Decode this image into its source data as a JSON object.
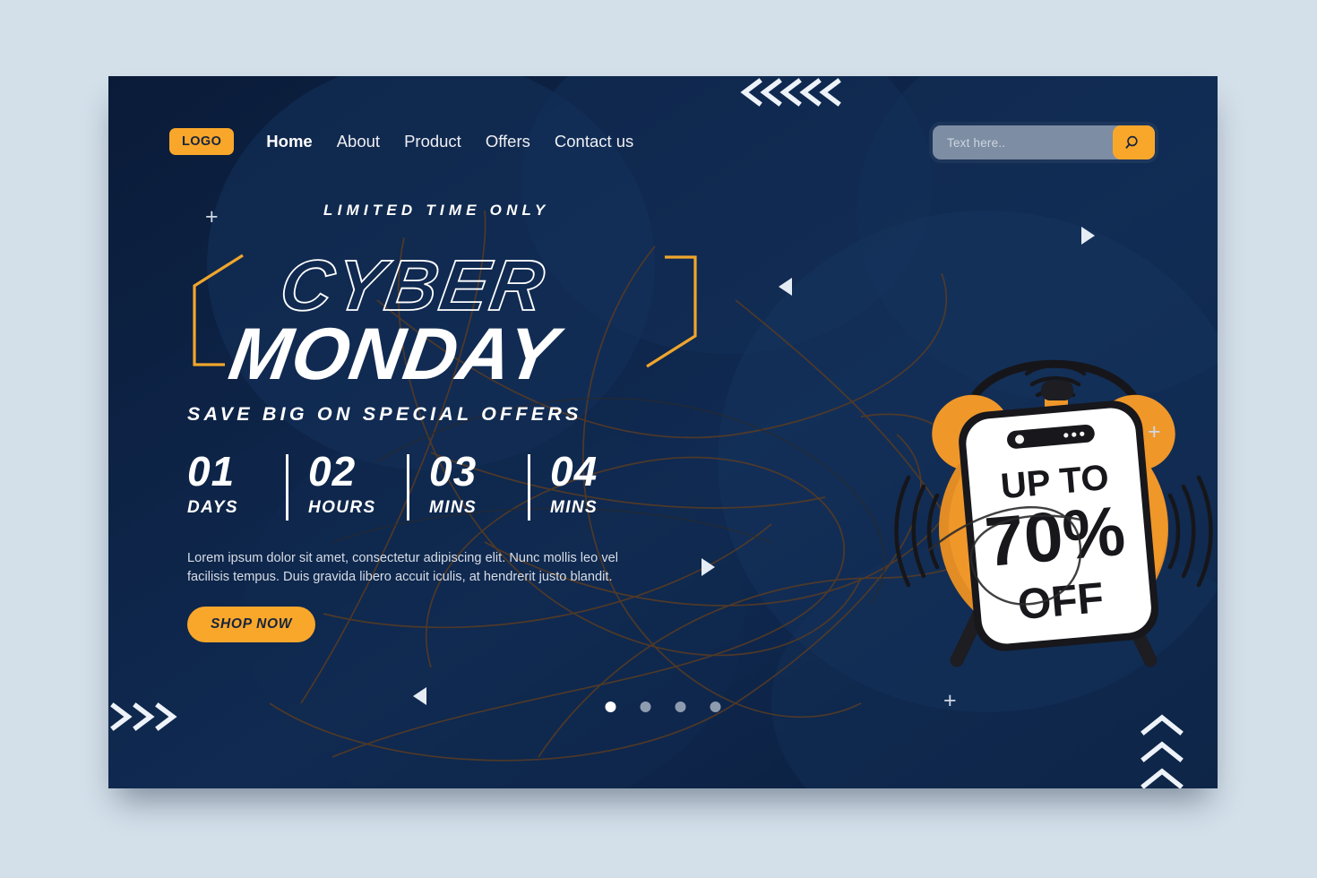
{
  "page": {
    "background_color": "#d3dfe9",
    "card_color": "#0b1f3f",
    "accent_color": "#f9a72b"
  },
  "nav": {
    "logo": "LOGO",
    "items": [
      {
        "label": "Home",
        "active": true
      },
      {
        "label": "About",
        "active": false
      },
      {
        "label": "Product",
        "active": false
      },
      {
        "label": "Offers",
        "active": false
      },
      {
        "label": "Contact us",
        "active": false
      }
    ]
  },
  "search": {
    "placeholder": "Text here..",
    "value": "",
    "icon": "search-icon"
  },
  "hero": {
    "kicker": "LIMITED TIME ONLY",
    "title_line1": "CYBER",
    "title_line2": "MONDAY",
    "subhead": "SAVE BIG ON SPECIAL OFFERS",
    "paragraph": "Lorem ipsum dolor sit amet, consectetur adipiscing elit. Nunc mollis leo vel facilisis tempus. Duis gravida libero accuit iculis, at hendrerit justo blandit.",
    "cta_label": "SHOP NOW"
  },
  "countdown": {
    "units": [
      {
        "value": "01",
        "label": "DAYS"
      },
      {
        "value": "02",
        "label": "HOURS"
      },
      {
        "value": "03",
        "label": "MINS"
      },
      {
        "value": "04",
        "label": "MINS"
      }
    ]
  },
  "promo": {
    "line1": "UP TO",
    "line2": "70%",
    "line3": "OFF"
  },
  "carousel": {
    "dots": [
      {
        "active": true
      },
      {
        "active": false
      },
      {
        "active": false
      },
      {
        "active": false
      }
    ]
  },
  "decorations": {
    "plus_glyph": "+",
    "chevrons_top_count": 5,
    "chevrons_bottom_left_count": 3,
    "chevrons_bottom_right_count": 3
  }
}
